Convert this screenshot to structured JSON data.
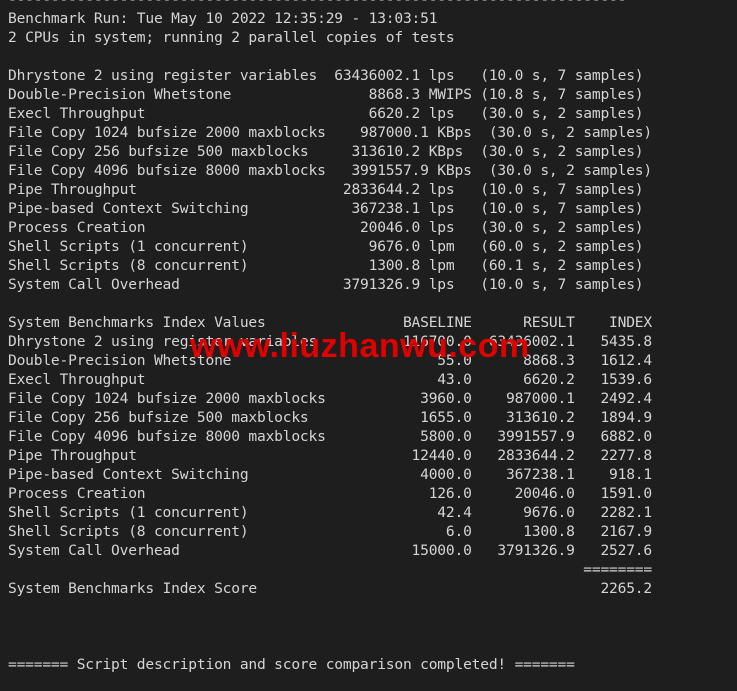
{
  "header": {
    "separator": "------------------------------------------------------------------------",
    "run_line": "Benchmark Run: Tue May 10 2022 12:35:29 - 13:03:51",
    "cpu_line": "2 CPUs in system; running 2 parallel copies of tests"
  },
  "results": [
    {
      "name": "Dhrystone 2 using register variables",
      "value": "63436002.1",
      "unit": "lps",
      "time": "10.0 s",
      "samples": "7 samples"
    },
    {
      "name": "Double-Precision Whetstone",
      "value": "8868.3",
      "unit": "MWIPS",
      "time": "10.8 s",
      "samples": "7 samples"
    },
    {
      "name": "Execl Throughput",
      "value": "6620.2",
      "unit": "lps",
      "time": "30.0 s",
      "samples": "2 samples"
    },
    {
      "name": "File Copy 1024 bufsize 2000 maxblocks",
      "value": "987000.1",
      "unit": "KBps",
      "time": "30.0 s",
      "samples": "2 samples"
    },
    {
      "name": "File Copy 256 bufsize 500 maxblocks",
      "value": "313610.2",
      "unit": "KBps",
      "time": "30.0 s",
      "samples": "2 samples"
    },
    {
      "name": "File Copy 4096 bufsize 8000 maxblocks",
      "value": "3991557.9",
      "unit": "KBps",
      "time": "30.0 s",
      "samples": "2 samples"
    },
    {
      "name": "Pipe Throughput",
      "value": "2833644.2",
      "unit": "lps",
      "time": "10.0 s",
      "samples": "7 samples"
    },
    {
      "name": "Pipe-based Context Switching",
      "value": "367238.1",
      "unit": "lps",
      "time": "10.0 s",
      "samples": "7 samples"
    },
    {
      "name": "Process Creation",
      "value": "20046.0",
      "unit": "lps",
      "time": "30.0 s",
      "samples": "2 samples"
    },
    {
      "name": "Shell Scripts (1 concurrent)",
      "value": "9676.0",
      "unit": "lpm",
      "time": "60.0 s",
      "samples": "2 samples"
    },
    {
      "name": "Shell Scripts (8 concurrent)",
      "value": "1300.8",
      "unit": "lpm",
      "time": "60.1 s",
      "samples": "2 samples"
    },
    {
      "name": "System Call Overhead",
      "value": "3791326.9",
      "unit": "lps",
      "time": "10.0 s",
      "samples": "7 samples"
    }
  ],
  "index": {
    "title": "System Benchmarks Index Values",
    "columns": [
      "BASELINE",
      "RESULT",
      "INDEX"
    ],
    "rows": [
      {
        "name": "Dhrystone 2 using register variables",
        "baseline": "116700.0",
        "result": "63436002.1",
        "index": "5435.8"
      },
      {
        "name": "Double-Precision Whetstone",
        "baseline": "55.0",
        "result": "8868.3",
        "index": "1612.4"
      },
      {
        "name": "Execl Throughput",
        "baseline": "43.0",
        "result": "6620.2",
        "index": "1539.6"
      },
      {
        "name": "File Copy 1024 bufsize 2000 maxblocks",
        "baseline": "3960.0",
        "result": "987000.1",
        "index": "2492.4"
      },
      {
        "name": "File Copy 256 bufsize 500 maxblocks",
        "baseline": "1655.0",
        "result": "313610.2",
        "index": "1894.9"
      },
      {
        "name": "File Copy 4096 bufsize 8000 maxblocks",
        "baseline": "5800.0",
        "result": "3991557.9",
        "index": "6882.0"
      },
      {
        "name": "Pipe Throughput",
        "baseline": "12440.0",
        "result": "2833644.2",
        "index": "2277.8"
      },
      {
        "name": "Pipe-based Context Switching",
        "baseline": "4000.0",
        "result": "367238.1",
        "index": "918.1"
      },
      {
        "name": "Process Creation",
        "baseline": "126.0",
        "result": "20046.0",
        "index": "1591.0"
      },
      {
        "name": "Shell Scripts (1 concurrent)",
        "baseline": "42.4",
        "result": "9676.0",
        "index": "2282.1"
      },
      {
        "name": "Shell Scripts (8 concurrent)",
        "baseline": "6.0",
        "result": "1300.8",
        "index": "2167.9"
      },
      {
        "name": "System Call Overhead",
        "baseline": "15000.0",
        "result": "3791326.9",
        "index": "2527.6"
      }
    ],
    "divider": "========",
    "score_label": "System Benchmarks Index Score",
    "score": "2265.2"
  },
  "footer": "======= Script description and score comparison completed! =======",
  "watermark": "www.liuzhanwu.com"
}
